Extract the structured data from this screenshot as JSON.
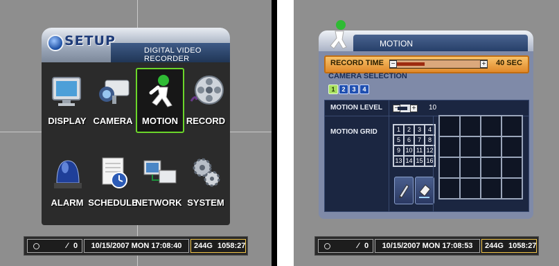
{
  "setup_screen": {
    "title": "SETUP",
    "subtitle": "DIGITAL VIDEO RECORDER",
    "menu": [
      {
        "id": "display",
        "label": "DISPLAY",
        "icon": "monitor-icon"
      },
      {
        "id": "camera",
        "label": "CAMERA",
        "icon": "camera-icon"
      },
      {
        "id": "motion",
        "label": "MOTION",
        "icon": "running-man-icon",
        "selected": true
      },
      {
        "id": "record",
        "label": "RECORD",
        "icon": "film-reel-icon"
      },
      {
        "id": "alarm",
        "label": "ALARM",
        "icon": "alarm-light-icon"
      },
      {
        "id": "schedule",
        "label": "SCHEDULE",
        "icon": "calendar-clock-icon"
      },
      {
        "id": "network",
        "label": "NETWORK",
        "icon": "network-computer-icon"
      },
      {
        "id": "system",
        "label": "SYSTEM",
        "icon": "gears-icon"
      }
    ],
    "status": {
      "count": "0",
      "datetime": "10/15/2007 MON 17:08:40",
      "hdd": "244G",
      "time": "1058:27"
    }
  },
  "motion_screen": {
    "title": "MOTION",
    "record_time_label": "RECORD TIME",
    "record_time_value": "40 SEC",
    "record_time_fraction": 0.34,
    "camera_selection_label": "CAMERA SELECTION",
    "cameras": [
      "1",
      "2",
      "3",
      "4"
    ],
    "active_camera": "1",
    "motion_level_label": "MOTION LEVEL",
    "motion_level_value": "10",
    "motion_grid_label": "MOTION GRID",
    "grid_numbers": [
      "1",
      "2",
      "3",
      "4",
      "5",
      "6",
      "7",
      "8",
      "9",
      "10",
      "11",
      "12",
      "13",
      "14",
      "15",
      "16"
    ],
    "status": {
      "count": "0",
      "datetime": "10/15/2007 MON 17:08:53",
      "hdd": "244G",
      "time": "1058:27"
    }
  },
  "colors": {
    "selected_border": "#6bd62a",
    "record_bar": "#e0892a",
    "panel_blue": "#27406a"
  }
}
